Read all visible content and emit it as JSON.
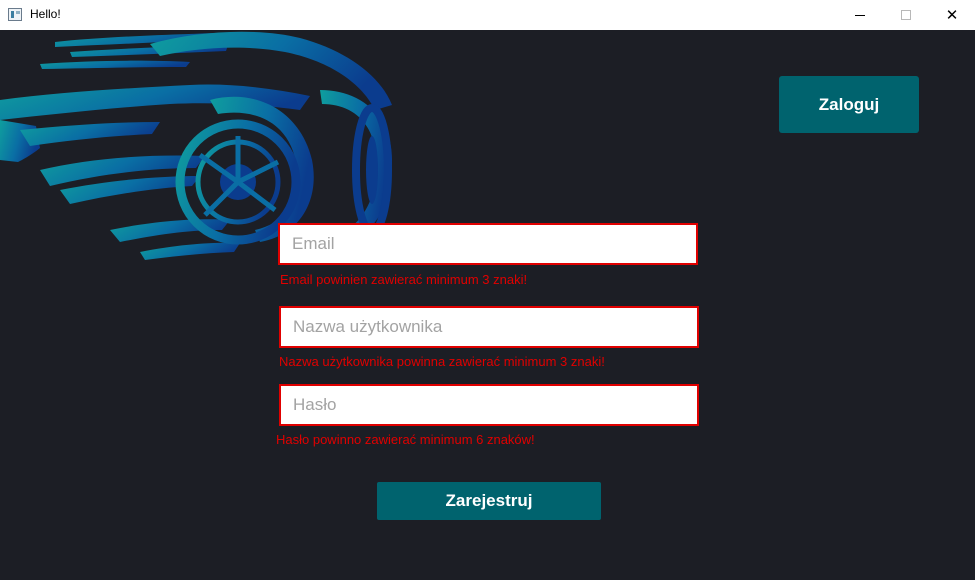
{
  "window": {
    "title": "Hello!",
    "close_glyph": "✕"
  },
  "header": {
    "login_label": "Zaloguj"
  },
  "form": {
    "email": {
      "placeholder": "Email",
      "error": "Email powinien zawierać minimum 3 znaki!"
    },
    "username": {
      "placeholder": "Nazwa użytkownika",
      "error": "Nazwa użytkownika powinna zawierać minimum 3 znaki!"
    },
    "password": {
      "placeholder": "Hasło",
      "error": "Hasło powinno zawierać minimum 6 znaków!"
    },
    "register_label": "Zarejestruj"
  },
  "colors": {
    "background": "#1c1e25",
    "accent": "#00636e",
    "error": "#e00000",
    "logo_teal": "#0f9e9e",
    "logo_blue": "#0b3c8e"
  }
}
